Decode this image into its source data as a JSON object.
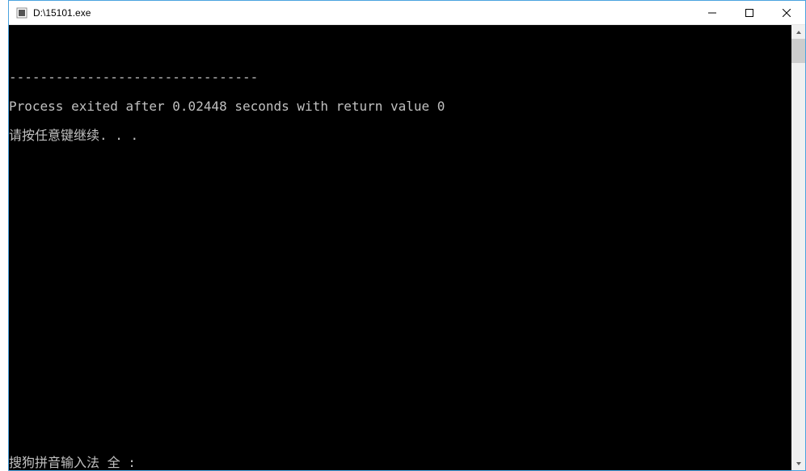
{
  "window": {
    "title": "D:\\15101.exe"
  },
  "console": {
    "separator": "--------------------------------",
    "exit_line": "Process exited after 0.02448 seconds with return value 0",
    "prompt_line": "请按任意键继续. . .",
    "ime_status": "搜狗拼音输入法 全 :"
  }
}
